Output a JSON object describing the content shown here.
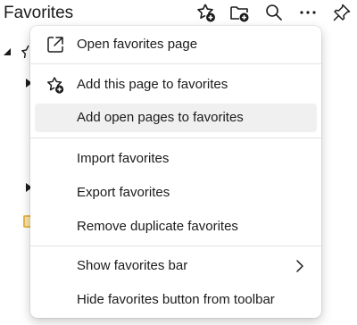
{
  "header": {
    "title": "Favorites",
    "icons": [
      "add-favorite-icon",
      "add-folder-icon",
      "search-icon",
      "more-icon",
      "pin-icon"
    ]
  },
  "menu": {
    "items": [
      {
        "label": "Open favorites page",
        "icon": "open-external-icon"
      },
      {
        "label": "Add this page to favorites",
        "icon": "star-add-icon"
      },
      {
        "label": "Add open pages to favorites",
        "highlighted": true
      },
      {
        "label": "Import favorites"
      },
      {
        "label": "Export favorites"
      },
      {
        "label": "Remove duplicate favorites"
      },
      {
        "label": "Show favorites bar",
        "submenu": true
      },
      {
        "label": "Hide favorites button from toolbar"
      }
    ]
  },
  "colors": {
    "menu_bg": "#ffffff",
    "hover_bg": "#f0f0f0",
    "text": "#1b1b1b",
    "separator": "#e3e3e3"
  }
}
